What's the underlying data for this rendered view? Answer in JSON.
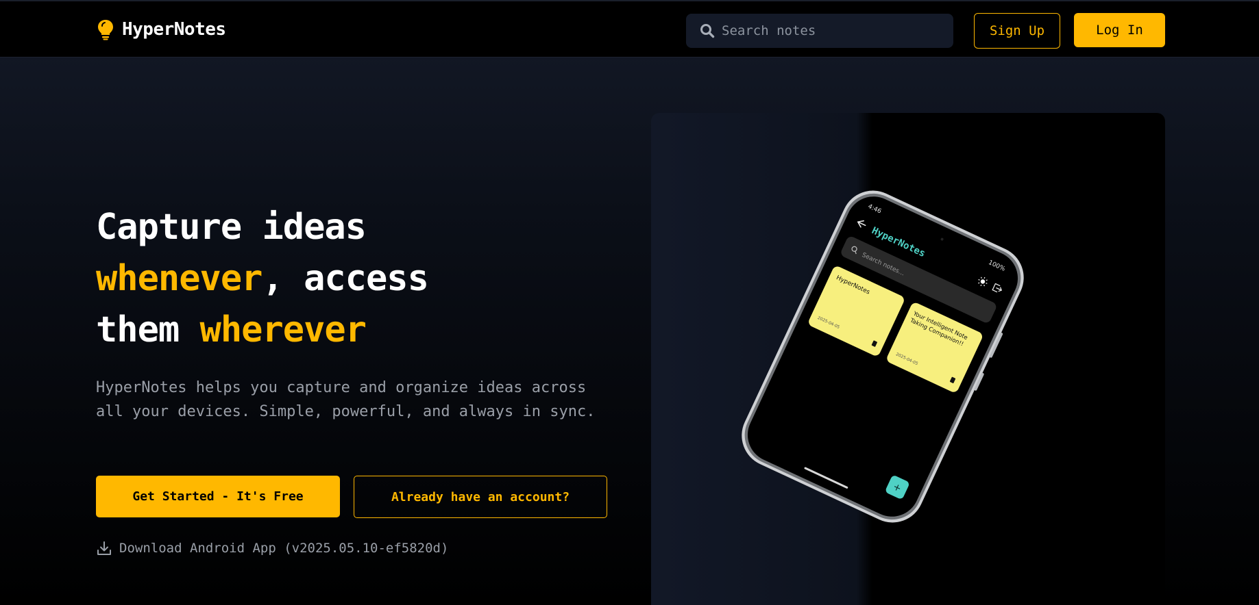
{
  "header": {
    "brand_name": "HyperNotes",
    "brand_icon": "lightbulb-icon",
    "search_placeholder": "Search notes",
    "signup_label": "Sign Up",
    "login_label": "Log In"
  },
  "hero": {
    "headline": {
      "part1": "Capture ideas",
      "highlight1": "whenever",
      "part2": ", access",
      "part3": "them ",
      "highlight2": "wherever"
    },
    "description": "HyperNotes helps you capture and organize ideas across all your devices. Simple, powerful, and always in sync.",
    "primary_cta": "Get Started - It's Free",
    "secondary_cta": "Already have an account?",
    "download_label": "Download Android App (v2025.05.10-ef5820d)"
  },
  "phone": {
    "status_time": "4:46",
    "status_right": "100%",
    "app_title": "HyperNotes",
    "search_placeholder": "Search notes...",
    "notes": [
      {
        "title": "HyperNotes",
        "date": "2025-04-05"
      },
      {
        "title_line1": "Your Intelligent Note",
        "title_line2": "Taking Companion!!",
        "date": "2025-04-05"
      }
    ],
    "fab_label": "+"
  },
  "colors": {
    "accent": "#ffb800",
    "note_yellow": "#f7ef7e",
    "fab_teal": "#4fd1c5",
    "header_bg": "#000000"
  }
}
